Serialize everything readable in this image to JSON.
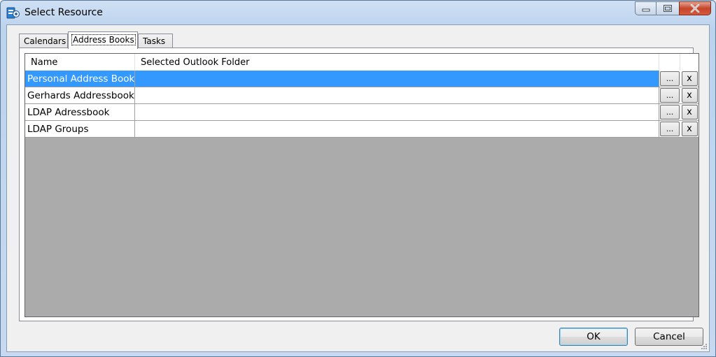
{
  "window": {
    "title": "Select Resource"
  },
  "tabs": [
    {
      "label": "Calendars",
      "active": false
    },
    {
      "label": "Address Books",
      "active": true
    },
    {
      "label": "Tasks",
      "active": false
    }
  ],
  "grid": {
    "columns": [
      "Name",
      "Selected Outlook Folder"
    ],
    "rows": [
      {
        "name": "Personal Address Book",
        "folder": "",
        "selected": true
      },
      {
        "name": "Gerhards Addressbook",
        "folder": "",
        "selected": false
      },
      {
        "name": "LDAP Adressbook",
        "folder": "",
        "selected": false
      },
      {
        "name": "LDAP Groups",
        "folder": "",
        "selected": false
      }
    ],
    "browse_label": "...",
    "clear_label": "x"
  },
  "buttons": {
    "ok": "OK",
    "cancel": "Cancel"
  },
  "colors": {
    "selection": "#3399ff",
    "grid_background": "#ababab",
    "close_button": "#c5452b"
  }
}
